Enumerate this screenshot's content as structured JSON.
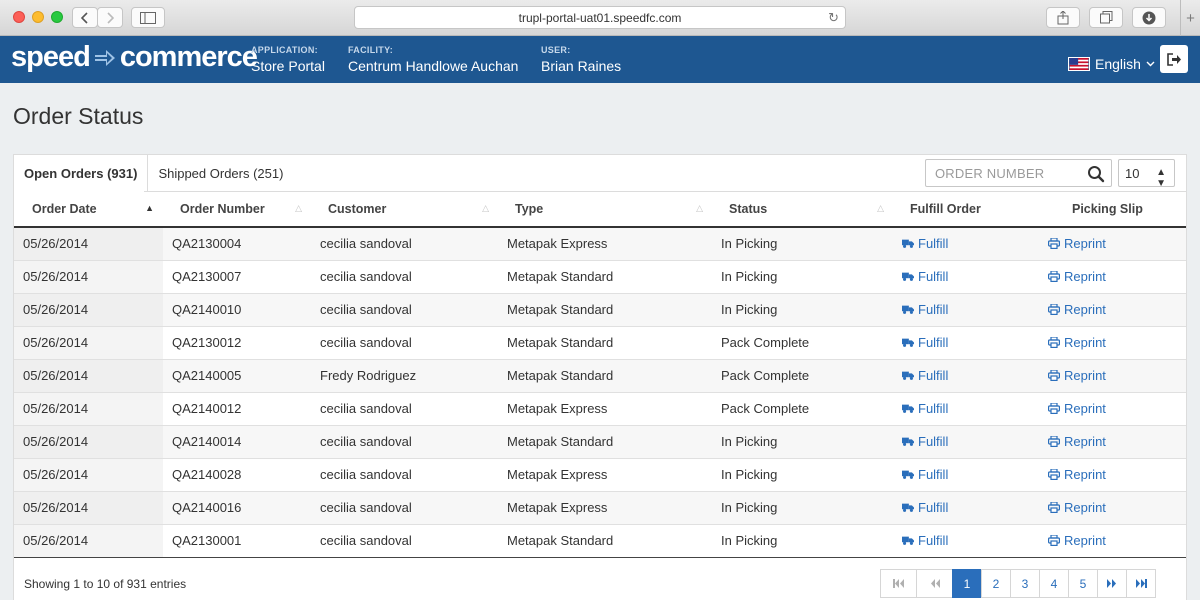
{
  "browser": {
    "url": "trupl-portal-uat01.speedfc.com"
  },
  "header": {
    "logo_left": "speed",
    "logo_right": "commerce",
    "application_label": "APPLICATION:",
    "application_value": "Store Portal",
    "facility_label": "FACILITY:",
    "facility_value": "Centrum Handlowe Auchan",
    "user_label": "USER:",
    "user_value": "Brian Raines",
    "language": "English"
  },
  "page": {
    "title": "Order Status"
  },
  "tabs": [
    {
      "label": "Open Orders (931)",
      "active": true
    },
    {
      "label": "Shipped Orders (251)",
      "active": false
    }
  ],
  "search": {
    "placeholder": "ORDER NUMBER"
  },
  "page_size": "10",
  "table": {
    "columns": [
      "Order Date",
      "Order Number",
      "Customer",
      "Type",
      "Status",
      "Fulfill Order",
      "Picking Slip"
    ],
    "rows": [
      {
        "date": "05/26/2014",
        "number": "QA2130004",
        "customer": "cecilia sandoval",
        "type": "Metapak Express",
        "status": "In Picking",
        "fulfill": "Fulfill",
        "slip": "Reprint"
      },
      {
        "date": "05/26/2014",
        "number": "QA2130007",
        "customer": "cecilia sandoval",
        "type": "Metapak Standard",
        "status": "In Picking",
        "fulfill": "Fulfill",
        "slip": "Reprint"
      },
      {
        "date": "05/26/2014",
        "number": "QA2140010",
        "customer": "cecilia sandoval",
        "type": "Metapak Standard",
        "status": "In Picking",
        "fulfill": "Fulfill",
        "slip": "Reprint"
      },
      {
        "date": "05/26/2014",
        "number": "QA2130012",
        "customer": "cecilia sandoval",
        "type": "Metapak Standard",
        "status": "Pack Complete",
        "fulfill": "Fulfill",
        "slip": "Reprint"
      },
      {
        "date": "05/26/2014",
        "number": "QA2140005",
        "customer": "Fredy Rodriguez",
        "type": "Metapak Standard",
        "status": "Pack Complete",
        "fulfill": "Fulfill",
        "slip": "Reprint"
      },
      {
        "date": "05/26/2014",
        "number": "QA2140012",
        "customer": "cecilia sandoval",
        "type": "Metapak Express",
        "status": "Pack Complete",
        "fulfill": "Fulfill",
        "slip": "Reprint"
      },
      {
        "date": "05/26/2014",
        "number": "QA2140014",
        "customer": "cecilia sandoval",
        "type": "Metapak Standard",
        "status": "In Picking",
        "fulfill": "Fulfill",
        "slip": "Reprint"
      },
      {
        "date": "05/26/2014",
        "number": "QA2140028",
        "customer": "cecilia sandoval",
        "type": "Metapak Express",
        "status": "In Picking",
        "fulfill": "Fulfill",
        "slip": "Reprint"
      },
      {
        "date": "05/26/2014",
        "number": "QA2140016",
        "customer": "cecilia sandoval",
        "type": "Metapak Express",
        "status": "In Picking",
        "fulfill": "Fulfill",
        "slip": "Reprint"
      },
      {
        "date": "05/26/2014",
        "number": "QA2130001",
        "customer": "cecilia sandoval",
        "type": "Metapak Standard",
        "status": "In Picking",
        "fulfill": "Fulfill",
        "slip": "Reprint"
      }
    ]
  },
  "footer": {
    "info": "Showing 1 to 10 of 931 entries"
  },
  "pagination": {
    "pages": [
      "1",
      "2",
      "3",
      "4",
      "5"
    ],
    "current": "1"
  },
  "colors": {
    "brand_blue": "#1e5791",
    "link_blue": "#2a6ebb"
  }
}
